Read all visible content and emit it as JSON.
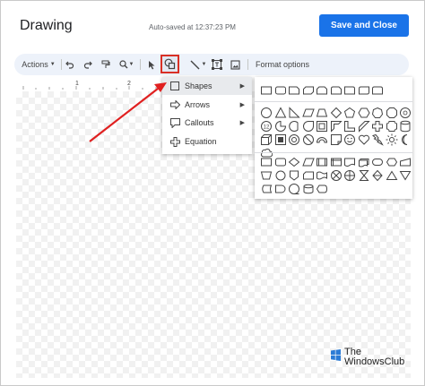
{
  "dialog": {
    "title": "Drawing",
    "autosave": "Auto-saved at 12:37:23 PM",
    "save_label": "Save and Close"
  },
  "toolbar": {
    "actions_label": "Actions",
    "format_label": "Format options",
    "icons": [
      "undo-icon",
      "redo-icon",
      "paint-format-icon",
      "zoom-icon",
      "select-icon",
      "shapes-icon",
      "line-icon",
      "text-box-icon",
      "image-icon"
    ]
  },
  "ruler": {
    "marks": [
      "1",
      "2"
    ]
  },
  "menu": {
    "items": [
      {
        "label": "Shapes",
        "icon": "square-icon"
      },
      {
        "label": "Arrows",
        "icon": "arrow-icon"
      },
      {
        "label": "Callouts",
        "icon": "callout-icon"
      },
      {
        "label": "Equation",
        "icon": "plus-icon"
      }
    ]
  },
  "watermark": {
    "line1": "The",
    "line2": "WindowsClub"
  },
  "colors": {
    "accent": "#1a73e8",
    "highlight": "#d93025",
    "toolbar_bg": "#edf2fa"
  }
}
